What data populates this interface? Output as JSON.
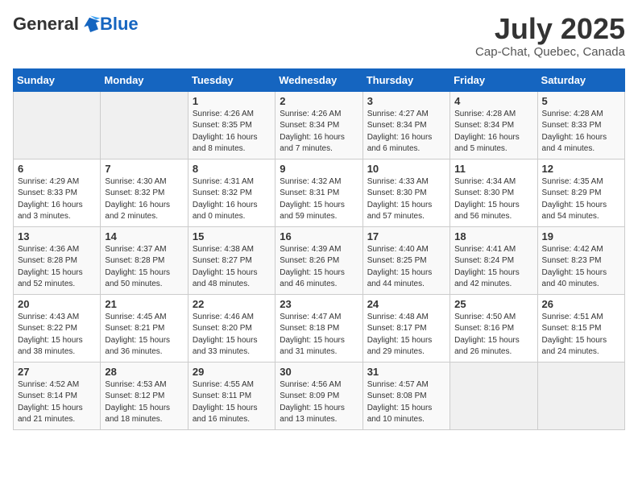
{
  "header": {
    "logo_general": "General",
    "logo_blue": "Blue",
    "month_title": "July 2025",
    "location": "Cap-Chat, Quebec, Canada"
  },
  "weekdays": [
    "Sunday",
    "Monday",
    "Tuesday",
    "Wednesday",
    "Thursday",
    "Friday",
    "Saturday"
  ],
  "weeks": [
    [
      {
        "day": "",
        "info": ""
      },
      {
        "day": "",
        "info": ""
      },
      {
        "day": "1",
        "info": "Sunrise: 4:26 AM\nSunset: 8:35 PM\nDaylight: 16 hours and 8 minutes."
      },
      {
        "day": "2",
        "info": "Sunrise: 4:26 AM\nSunset: 8:34 PM\nDaylight: 16 hours and 7 minutes."
      },
      {
        "day": "3",
        "info": "Sunrise: 4:27 AM\nSunset: 8:34 PM\nDaylight: 16 hours and 6 minutes."
      },
      {
        "day": "4",
        "info": "Sunrise: 4:28 AM\nSunset: 8:34 PM\nDaylight: 16 hours and 5 minutes."
      },
      {
        "day": "5",
        "info": "Sunrise: 4:28 AM\nSunset: 8:33 PM\nDaylight: 16 hours and 4 minutes."
      }
    ],
    [
      {
        "day": "6",
        "info": "Sunrise: 4:29 AM\nSunset: 8:33 PM\nDaylight: 16 hours and 3 minutes."
      },
      {
        "day": "7",
        "info": "Sunrise: 4:30 AM\nSunset: 8:32 PM\nDaylight: 16 hours and 2 minutes."
      },
      {
        "day": "8",
        "info": "Sunrise: 4:31 AM\nSunset: 8:32 PM\nDaylight: 16 hours and 0 minutes."
      },
      {
        "day": "9",
        "info": "Sunrise: 4:32 AM\nSunset: 8:31 PM\nDaylight: 15 hours and 59 minutes."
      },
      {
        "day": "10",
        "info": "Sunrise: 4:33 AM\nSunset: 8:30 PM\nDaylight: 15 hours and 57 minutes."
      },
      {
        "day": "11",
        "info": "Sunrise: 4:34 AM\nSunset: 8:30 PM\nDaylight: 15 hours and 56 minutes."
      },
      {
        "day": "12",
        "info": "Sunrise: 4:35 AM\nSunset: 8:29 PM\nDaylight: 15 hours and 54 minutes."
      }
    ],
    [
      {
        "day": "13",
        "info": "Sunrise: 4:36 AM\nSunset: 8:28 PM\nDaylight: 15 hours and 52 minutes."
      },
      {
        "day": "14",
        "info": "Sunrise: 4:37 AM\nSunset: 8:28 PM\nDaylight: 15 hours and 50 minutes."
      },
      {
        "day": "15",
        "info": "Sunrise: 4:38 AM\nSunset: 8:27 PM\nDaylight: 15 hours and 48 minutes."
      },
      {
        "day": "16",
        "info": "Sunrise: 4:39 AM\nSunset: 8:26 PM\nDaylight: 15 hours and 46 minutes."
      },
      {
        "day": "17",
        "info": "Sunrise: 4:40 AM\nSunset: 8:25 PM\nDaylight: 15 hours and 44 minutes."
      },
      {
        "day": "18",
        "info": "Sunrise: 4:41 AM\nSunset: 8:24 PM\nDaylight: 15 hours and 42 minutes."
      },
      {
        "day": "19",
        "info": "Sunrise: 4:42 AM\nSunset: 8:23 PM\nDaylight: 15 hours and 40 minutes."
      }
    ],
    [
      {
        "day": "20",
        "info": "Sunrise: 4:43 AM\nSunset: 8:22 PM\nDaylight: 15 hours and 38 minutes."
      },
      {
        "day": "21",
        "info": "Sunrise: 4:45 AM\nSunset: 8:21 PM\nDaylight: 15 hours and 36 minutes."
      },
      {
        "day": "22",
        "info": "Sunrise: 4:46 AM\nSunset: 8:20 PM\nDaylight: 15 hours and 33 minutes."
      },
      {
        "day": "23",
        "info": "Sunrise: 4:47 AM\nSunset: 8:18 PM\nDaylight: 15 hours and 31 minutes."
      },
      {
        "day": "24",
        "info": "Sunrise: 4:48 AM\nSunset: 8:17 PM\nDaylight: 15 hours and 29 minutes."
      },
      {
        "day": "25",
        "info": "Sunrise: 4:50 AM\nSunset: 8:16 PM\nDaylight: 15 hours and 26 minutes."
      },
      {
        "day": "26",
        "info": "Sunrise: 4:51 AM\nSunset: 8:15 PM\nDaylight: 15 hours and 24 minutes."
      }
    ],
    [
      {
        "day": "27",
        "info": "Sunrise: 4:52 AM\nSunset: 8:14 PM\nDaylight: 15 hours and 21 minutes."
      },
      {
        "day": "28",
        "info": "Sunrise: 4:53 AM\nSunset: 8:12 PM\nDaylight: 15 hours and 18 minutes."
      },
      {
        "day": "29",
        "info": "Sunrise: 4:55 AM\nSunset: 8:11 PM\nDaylight: 15 hours and 16 minutes."
      },
      {
        "day": "30",
        "info": "Sunrise: 4:56 AM\nSunset: 8:09 PM\nDaylight: 15 hours and 13 minutes."
      },
      {
        "day": "31",
        "info": "Sunrise: 4:57 AM\nSunset: 8:08 PM\nDaylight: 15 hours and 10 minutes."
      },
      {
        "day": "",
        "info": ""
      },
      {
        "day": "",
        "info": ""
      }
    ]
  ]
}
